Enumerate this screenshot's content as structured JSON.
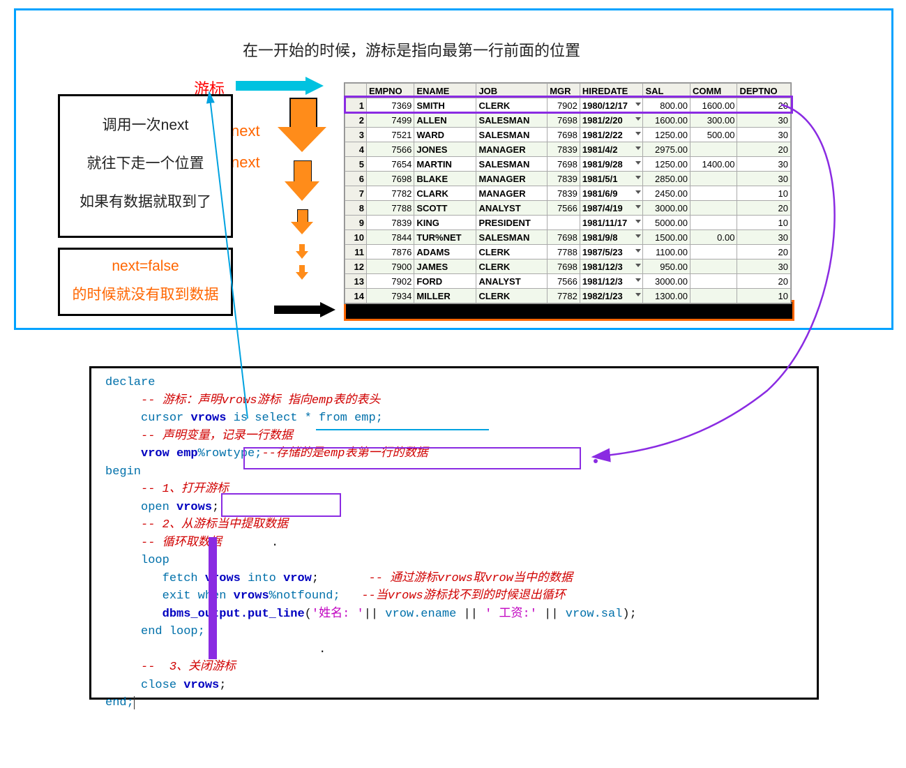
{
  "top": {
    "title": "在一开始的时候，游标是指向最第一行前面的位置",
    "cursor_label": "游标",
    "next1": "next",
    "next2": "next",
    "box1_l1": "调用一次next",
    "box1_l2": "就往下走一个位置",
    "box1_l3": "如果有数据就取到了",
    "box2_l1": "next=false",
    "box2_l2": "的时候就没有取到数据"
  },
  "table": {
    "headers": [
      "",
      "EMPNO",
      "ENAME",
      "JOB",
      "MGR",
      "HIREDATE",
      "SAL",
      "COMM",
      "DEPTNO"
    ],
    "rows": [
      {
        "rn": 1,
        "EMPNO": "7369",
        "ENAME": "SMITH",
        "JOB": "CLERK",
        "MGR": "7902",
        "HIRE": "1980/12/17",
        "SAL": "800.00",
        "COMM": "1600.00",
        "DEPT": "20"
      },
      {
        "rn": 2,
        "EMPNO": "7499",
        "ENAME": "ALLEN",
        "JOB": "SALESMAN",
        "MGR": "7698",
        "HIRE": "1981/2/20",
        "SAL": "1600.00",
        "COMM": "300.00",
        "DEPT": "30"
      },
      {
        "rn": 3,
        "EMPNO": "7521",
        "ENAME": "WARD",
        "JOB": "SALESMAN",
        "MGR": "7698",
        "HIRE": "1981/2/22",
        "SAL": "1250.00",
        "COMM": "500.00",
        "DEPT": "30"
      },
      {
        "rn": 4,
        "EMPNO": "7566",
        "ENAME": "JONES",
        "JOB": "MANAGER",
        "MGR": "7839",
        "HIRE": "1981/4/2",
        "SAL": "2975.00",
        "COMM": "",
        "DEPT": "20"
      },
      {
        "rn": 5,
        "EMPNO": "7654",
        "ENAME": "MARTIN",
        "JOB": "SALESMAN",
        "MGR": "7698",
        "HIRE": "1981/9/28",
        "SAL": "1250.00",
        "COMM": "1400.00",
        "DEPT": "30"
      },
      {
        "rn": 6,
        "EMPNO": "7698",
        "ENAME": "BLAKE",
        "JOB": "MANAGER",
        "MGR": "7839",
        "HIRE": "1981/5/1",
        "SAL": "2850.00",
        "COMM": "",
        "DEPT": "30"
      },
      {
        "rn": 7,
        "EMPNO": "7782",
        "ENAME": "CLARK",
        "JOB": "MANAGER",
        "MGR": "7839",
        "HIRE": "1981/6/9",
        "SAL": "2450.00",
        "COMM": "",
        "DEPT": "10"
      },
      {
        "rn": 8,
        "EMPNO": "7788",
        "ENAME": "SCOTT",
        "JOB": "ANALYST",
        "MGR": "7566",
        "HIRE": "1987/4/19",
        "SAL": "3000.00",
        "COMM": "",
        "DEPT": "20"
      },
      {
        "rn": 9,
        "EMPNO": "7839",
        "ENAME": "KING",
        "JOB": "PRESIDENT",
        "MGR": "",
        "HIRE": "1981/11/17",
        "SAL": "5000.00",
        "COMM": "",
        "DEPT": "10"
      },
      {
        "rn": 10,
        "EMPNO": "7844",
        "ENAME": "TUR%NET",
        "JOB": "SALESMAN",
        "MGR": "7698",
        "HIRE": "1981/9/8",
        "SAL": "1500.00",
        "COMM": "0.00",
        "DEPT": "30"
      },
      {
        "rn": 11,
        "EMPNO": "7876",
        "ENAME": "ADAMS",
        "JOB": "CLERK",
        "MGR": "7788",
        "HIRE": "1987/5/23",
        "SAL": "1100.00",
        "COMM": "",
        "DEPT": "20"
      },
      {
        "rn": 12,
        "EMPNO": "7900",
        "ENAME": "JAMES",
        "JOB": "CLERK",
        "MGR": "7698",
        "HIRE": "1981/12/3",
        "SAL": "950.00",
        "COMM": "",
        "DEPT": "30"
      },
      {
        "rn": 13,
        "EMPNO": "7902",
        "ENAME": "FORD",
        "JOB": "ANALYST",
        "MGR": "7566",
        "HIRE": "1981/12/3",
        "SAL": "3000.00",
        "COMM": "",
        "DEPT": "20"
      },
      {
        "rn": 14,
        "EMPNO": "7934",
        "ENAME": "MILLER",
        "JOB": "CLERK",
        "MGR": "7782",
        "HIRE": "1982/1/23",
        "SAL": "1300.00",
        "COMM": "",
        "DEPT": "10"
      }
    ]
  },
  "code": {
    "declare": "declare",
    "c1": "-- 游标：声明vrows游标 指向emp表的表头",
    "l_cursor": "cursor",
    "vrows": "vrows",
    "iselect": "is select * from emp;",
    "c2": "-- 声明变量，记录一行数据",
    "vrow": "vrow",
    "emp": "emp",
    "rowtype": "%rowtype;",
    "c3": "--存储的是emp表第一行的数据",
    "begin": "begin",
    "c4": "-- 1、打开游标",
    "open": "open",
    "semi": ";",
    "c5": "-- 2、从游标当中提取数据",
    "c6": "-- 循环取数据",
    "loop": "loop",
    "fetch": "fetch",
    "into": "into",
    "c7": "-- 通过游标vrows取vrow当中的数据",
    "exitwhen": "exit when",
    "notfound": "%notfound;",
    "c8": "--当vrows游标找不到的时候退出循环",
    "dbms": "dbms_output.put_line",
    "s1": "'姓名: '",
    "cat": "||",
    "ve": "vrow.ename",
    "s2": "' 工资:'",
    "vs": "vrow.sal",
    "endloop": "end loop;",
    "c9": "--  3、关闭游标",
    "close": "close",
    "end": "end;"
  }
}
